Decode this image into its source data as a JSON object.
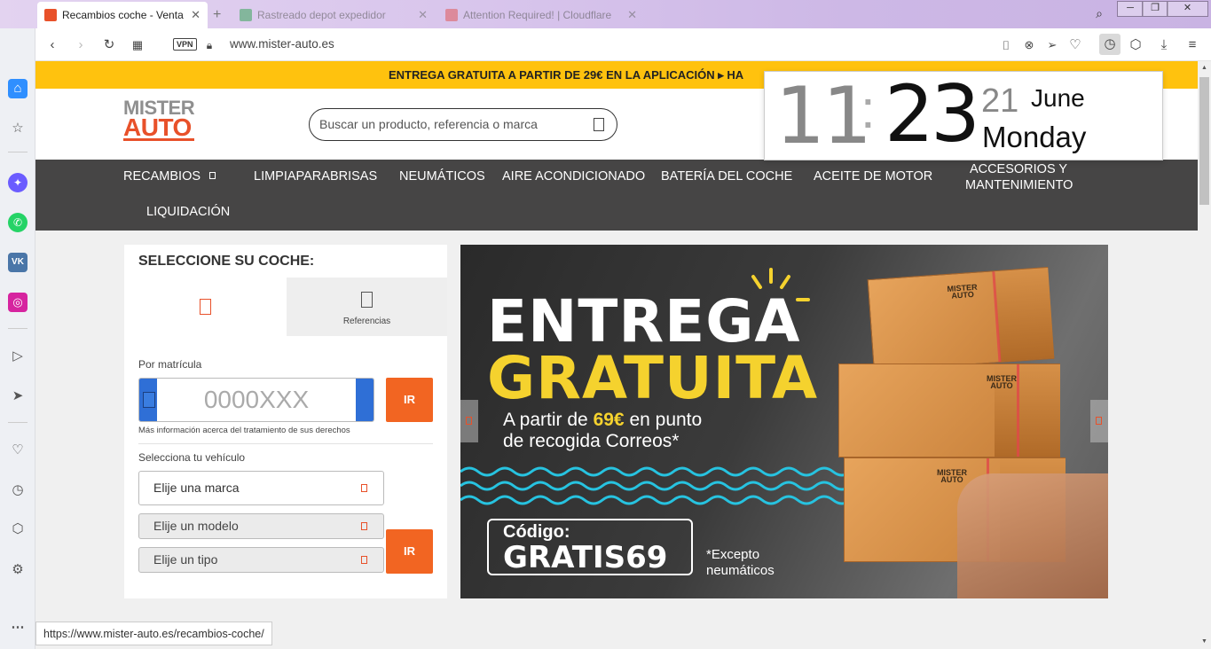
{
  "browser": {
    "tabs": [
      {
        "title": "Recambios coche - Venta c",
        "active": true,
        "favicon_color": "#e8512a"
      },
      {
        "title": "Rastreado depot expedidor",
        "active": false,
        "favicon_color": "#3aa55a"
      },
      {
        "title": "Attention Required! | Cloudflare",
        "active": false,
        "favicon_color": "#e05a5a"
      }
    ],
    "new_tab_icon": "plus-icon",
    "window_controls": {
      "minimize": "─",
      "maximize": "❐",
      "close": "✕"
    },
    "vpn_label": "VPN",
    "url": "www.mister-auto.es",
    "status_url": "https://www.mister-auto.es/recambios-coche/"
  },
  "clock": {
    "hours": "11",
    "colon": ":",
    "minutes": "23",
    "day": "21",
    "month": "June",
    "weekday": "Monday"
  },
  "site": {
    "promo": "ENTREGA GRATUITA A PARTIR DE 29€ EN LA APLICACIÓN ▸ HA",
    "logo": {
      "line1": "MISTER",
      "line2": "AUTO"
    },
    "search_placeholder": "Buscar un producto, referencia o marca",
    "nav": {
      "recambios": "RECAMBIOS",
      "limpiaparabrisas": "LIMPIAPARABRISAS",
      "neumaticos": "NEUMÁTICOS",
      "aire": "AIRE ACONDICIONADO",
      "bateria": "BATERÍA DEL COCHE",
      "aceite": "ACEITE DE MOTOR",
      "accesorios_1": "ACCESORIOS Y",
      "accesorios_2": "MANTENIMIENTO",
      "liquidacion": "LIQUIDACIÓN"
    },
    "selector": {
      "title": "SELECCIONE SU COCHE:",
      "tab_referencias": "Referencias",
      "plate_label": "Por matrícula",
      "plate_placeholder": "0000XXX",
      "go": "IR",
      "rights_note": "Más información acerca del tratamiento de sus derechos",
      "vehicle_label": "Selecciona tu vehículo",
      "brand": "Elije una marca",
      "model": "Elije un modelo",
      "type": "Elije un tipo"
    },
    "banner": {
      "line1": "ENTREGA",
      "line2": "GRATUITA",
      "sub_prefix": "A partir de ",
      "sub_amount": "69€",
      "sub_suffix": " en punto",
      "sub_line2": "de recogida Correos*",
      "code_label": "Código:",
      "code": "GRATIS69",
      "except1": "*Excepto",
      "except2": "neumáticos",
      "box_tag1": "MISTER",
      "box_tag2": "AUTO",
      "accent": "#f5d22e"
    }
  },
  "colors": {
    "promo_bg": "#ffc20e",
    "nav_bg": "#464545",
    "brand_orange": "#e8512a",
    "button_orange": "#f26522",
    "plate_blue": "#2f6fd6"
  }
}
